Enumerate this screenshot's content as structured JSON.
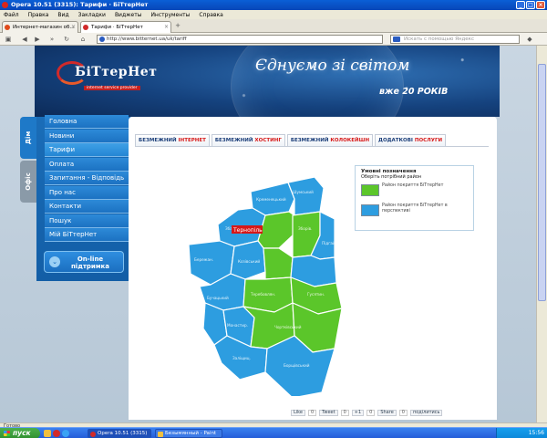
{
  "window": {
    "title": "Opera 10.51 (3315): Тарифи · БіТтерНет"
  },
  "menu": [
    "Файл",
    "Правка",
    "Вид",
    "Закладки",
    "Виджеты",
    "Инструменты",
    "Справка"
  ],
  "browser_tabs": [
    {
      "label": "Интернет-магазин об...",
      "active": false
    },
    {
      "label": "Тарифи · БіТтерНет",
      "active": true
    }
  ],
  "address": {
    "url": "http://www.bitternet.ua/uk/tariff",
    "search_placeholder": "Искать с помощью Яндекс"
  },
  "header": {
    "logo_name": "БіТтерНет",
    "logo_tag": "internet service provider",
    "slogan": "Єднуємо зі світом",
    "slogan_years": "вже 20 РОКІВ"
  },
  "side_tabs": {
    "dii": "Дім",
    "ofis": "Офіс"
  },
  "nav": [
    {
      "label": "Головна",
      "active": false
    },
    {
      "label": "Новини",
      "active": false
    },
    {
      "label": "Тарифи",
      "active": true
    },
    {
      "label": "Оплата",
      "active": false
    },
    {
      "label": "Запитання - Відповідь",
      "active": false
    },
    {
      "label": "Про нас",
      "active": false
    },
    {
      "label": "Контакти",
      "active": false
    },
    {
      "label": "Пошук",
      "active": false
    },
    {
      "label": "Мій БіТтерНет",
      "active": false
    }
  ],
  "online_button": {
    "line1": "On-line",
    "line2": "підтримка"
  },
  "content_tabs": [
    {
      "prefix": "БЕЗМЕЖНИЙ ",
      "highlight": "ІНТЕРНЕТ",
      "active": true
    },
    {
      "prefix": "БЕЗМЕЖНИЙ ",
      "highlight": "ХОСТИНГ",
      "active": false
    },
    {
      "prefix": "БЕЗМЕЖНИЙ ",
      "highlight": "КОЛОКЕЙШН",
      "active": false
    },
    {
      "prefix": "ДОДАТКОВІ ",
      "highlight": "ПОСЛУГИ",
      "active": false
    }
  ],
  "map": {
    "city_label": "Тернопіль",
    "covered_color": "#5bc62a",
    "planned_color": "#2d9de0"
  },
  "legend": {
    "title": "Умовні позначення",
    "subtitle": "Оберіть потрібний район",
    "covered": "Район покриття БіТтерНет",
    "planned": "Район покриття БіТтерНет в перспективі"
  },
  "share": {
    "like": "Like",
    "like_count": "0",
    "tweet": "Tweet",
    "tweet_count": "0",
    "gplus": "+1",
    "gplus_count": "0",
    "linkedin": "Share",
    "linkedin_count": "0",
    "more": "поділитись"
  },
  "status": {
    "text": "Готово"
  },
  "taskbar": {
    "start": "пуск",
    "tasks": [
      {
        "label": "Opera 10.51 (3315)",
        "active": true
      },
      {
        "label": "Безымянный - Paint",
        "active": false
      }
    ],
    "lang": "EN",
    "clock": "15:56"
  }
}
